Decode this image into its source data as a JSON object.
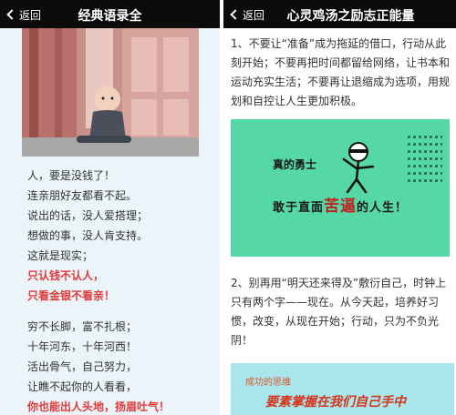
{
  "left": {
    "back_label": "返回",
    "title": "经典语录全",
    "lines": [
      {
        "text": "人，要是没钱了！",
        "highlight": false
      },
      {
        "text": "连亲朋好友都看不起。",
        "highlight": false
      },
      {
        "text": "说出的话，没人爱搭理；",
        "highlight": false
      },
      {
        "text": "想做的事，没人肯支持。",
        "highlight": false
      },
      {
        "text": "这就是现实；",
        "highlight": false
      },
      {
        "text": "只认钱不认人，",
        "highlight": true
      },
      {
        "text": "只看金银不看亲！",
        "highlight": true
      },
      {
        "text": "穷不长脚，富不扎根；",
        "highlight": false
      },
      {
        "text": "十年河东，十年河西！",
        "highlight": false
      },
      {
        "text": "活出骨气，自己努力，",
        "highlight": false
      },
      {
        "text": "让瞧不起你的人看看，",
        "highlight": false
      },
      {
        "text": "你也能出人头地，扬眉吐气！",
        "highlight": true
      }
    ]
  },
  "right": {
    "back_label": "返回",
    "title": "心灵鸡汤之励志正能量",
    "para1": "1、不要让“准备”成为拖延的借口，行动从此刻开始；不要再把时间都留给网络，让书本和运动充实生活；不要再让退缩成为选项，用规划和自控让人生更加积极。",
    "card": {
      "line1": "真的勇士",
      "line2_pre": "敢于直面",
      "line2_b1": "苦",
      "line2_b2": "逼",
      "line2_post": "的人生！"
    },
    "para2": "2、别再用“明天还来得及”敷衍自己，时钟上只有两个字——现在。从今天起，培养好习惯，改变，从现在开始；行动，只为不负光阴！",
    "banner": {
      "small": "成功的思维",
      "big": "要素掌握在我们自己手中"
    }
  },
  "colors": {
    "navbar": "#0b0b0b",
    "highlight_red": "#e23a3a",
    "card_green": "#55d7a6",
    "banner_cyan": "#a8e6eb"
  },
  "icons": [
    "chevron-left-icon"
  ]
}
